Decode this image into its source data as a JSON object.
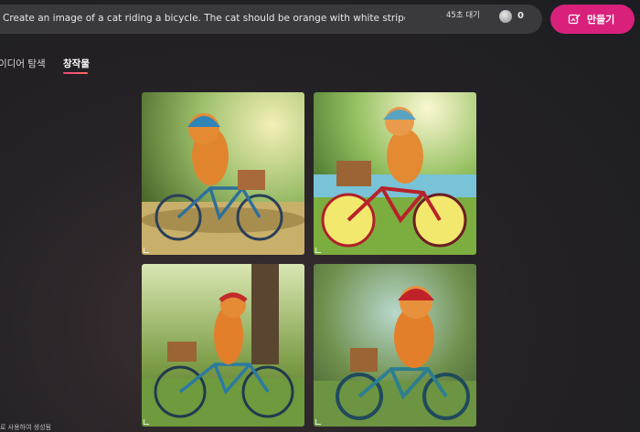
{
  "search": {
    "prompt": "Create an image of a cat riding a bicycle. The cat should be orange with white stripes and wear a"
  },
  "status": {
    "wait": "45초 대기",
    "coins": "0",
    "coin_icon": "coin-icon"
  },
  "create_button": {
    "label": "만들기",
    "icon": "create-image-icon",
    "color": "#d9217c"
  },
  "tabs": [
    {
      "label": "이디어 탐색",
      "active": false
    },
    {
      "label": "창작물",
      "active": true
    }
  ],
  "gallery": [
    {
      "description": "orange cat with blue helmet riding a blue bicycle with basket"
    },
    {
      "description": "orange cat with blue helmet riding a red bicycle by a lake"
    },
    {
      "description": "orange cat with red bandana riding a teal bicycle"
    },
    {
      "description": "orange cat with red helmet riding a teal bicycle"
    }
  ],
  "footer": {
    "text": "로 사용하여 생성됨"
  }
}
